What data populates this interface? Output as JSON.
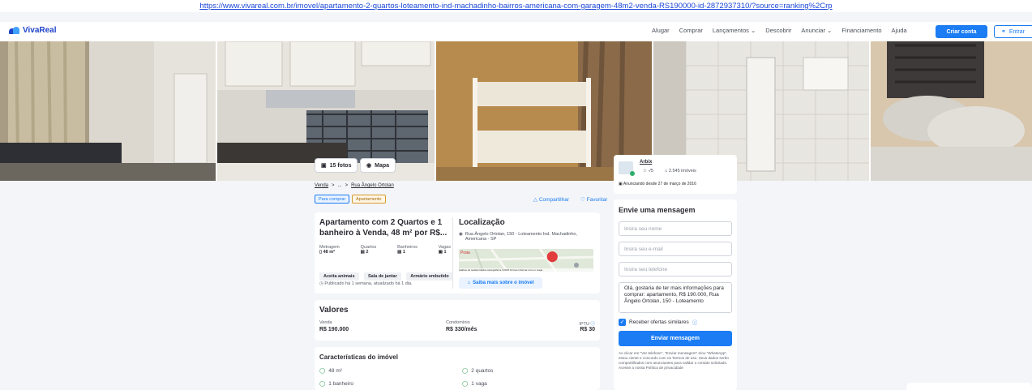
{
  "url": "https://www.vivareal.com.br/imovel/apartamento-2-quartos-loteamento-ind-machadinho-bairros-americana-com-garagem-48m2-venda-RS190000-id-2872937310/?source=ranking%2Crp",
  "brand": "VivaReal",
  "nav": {
    "items": [
      "Alugar",
      "Comprar",
      "Lançamentos ⌄",
      "Descobrir",
      "Anunciar ⌄",
      "Financiamento",
      "Ajuda"
    ],
    "criar_conta": "Criar conta",
    "entrar": "Entrar"
  },
  "gallery": {
    "fotos": "15 fotos",
    "mapa": "Mapa"
  },
  "breadcrumb": {
    "venda": "Venda",
    "sep1": ">",
    "ellipsis": "...",
    "sep2": ">",
    "rua": "Rua Ângelo Ortolan"
  },
  "tags": {
    "comprar": "Para comprar",
    "tipo": "Apartamento"
  },
  "actions": {
    "compartilhar": "Compartilhar",
    "favoritar": "Favoritar"
  },
  "listing": {
    "title": "Apartamento com 2 Quartos e 1 banheiro à Venda, 48 m² por R$...",
    "stats": [
      {
        "label": "Metragem",
        "value": "48 m²"
      },
      {
        "label": "Quartos",
        "value": "2"
      },
      {
        "label": "Banheiros",
        "value": "1"
      },
      {
        "label": "Vagas",
        "value": "1"
      }
    ],
    "amenities": [
      "Aceita animais",
      "Sala de jantar",
      "Armário embutido"
    ],
    "published": "Publicado há 1 semana, atualizado há 1 dia."
  },
  "location": {
    "title": "Localização",
    "address": "Rua Ângelo Ortolan, 150 - Loteamento Ind. Machadinho, Americana - SP",
    "map_place": "Praia",
    "map_footer": "Atalhos do teclado   Dados cartográficos ©2025   Termos   Informar erro no mapa",
    "saiba_mais": "Saiba mais sobre o imóvel"
  },
  "valores": {
    "title": "Valores",
    "venda_label": "Venda",
    "venda_value": "R$ 190.000",
    "condominio_label": "Condomínio",
    "condominio_value": "R$ 330/mês",
    "iptu_label": "IPTU",
    "iptu_value": "R$ 30"
  },
  "caracteristicas": {
    "title": "Características do imóvel",
    "items": [
      "48 m²",
      "2 quartos",
      "1 banheiro",
      "1 vaga"
    ]
  },
  "advertiser": {
    "name": "Arbix",
    "rating": "☆ -/5",
    "imoveis": "2.545 imóveis",
    "since": "Anunciando desde 27 de março de 2016"
  },
  "contact": {
    "title": "Envie uma mensagem",
    "nome_placeholder": "Insira seu nome",
    "email_placeholder": "Insira seu e-mail",
    "telefone_placeholder": "Insira seu telefone",
    "message": "Olá, gostaria de ter mais informações para comprar: apartamento, R$ 190.000, Rua Ângelo Ortolan, 150 - Loteamento",
    "checkbox_label": "Receber ofertas similares",
    "send": "Enviar mensagem",
    "legal": "Ao clicar em \"Ver telefone\", \"Enviar mensagem\" e/ou \"WhatsApp\", estou ciente e concordo com os Termos de uso. Seus dados serão compartilhados com anunciantes para validar o contato solicitado. Acesse a nossa Política de privacidade"
  }
}
